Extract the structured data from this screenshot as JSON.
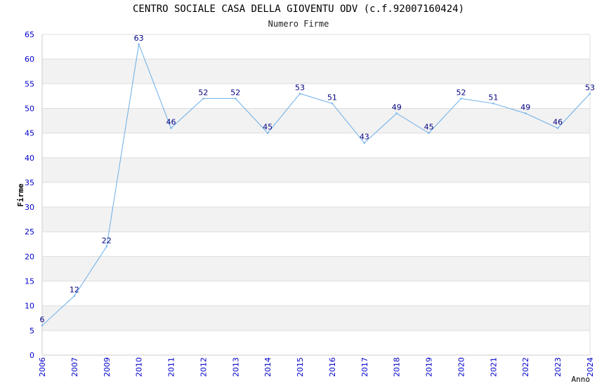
{
  "chart_data": {
    "type": "line",
    "title": "CENTRO SOCIALE CASA DELLA GIOVENTU ODV (c.f.92007160424)",
    "subtitle": "Numero Firme",
    "xlabel": "Anno",
    "ylabel": "Firme",
    "categories": [
      "2006",
      "2007",
      "2009",
      "2010",
      "2011",
      "2012",
      "2013",
      "2014",
      "2015",
      "2016",
      "2017",
      "2018",
      "2019",
      "2020",
      "2021",
      "2022",
      "2023",
      "2024"
    ],
    "series": [
      {
        "values": [
          6,
          12,
          22,
          63,
          46,
          52,
          52,
          45,
          53,
          51,
          43,
          49,
          45,
          52,
          51,
          49,
          46,
          53
        ]
      }
    ],
    "ylim": [
      0,
      65
    ],
    "yticks": [
      0,
      5,
      10,
      15,
      20,
      25,
      30,
      35,
      40,
      45,
      50,
      55,
      60,
      65
    ],
    "grid": "horizontal alternating bands",
    "colors": {
      "line": "#6aaee8",
      "band": "#f2f2f2",
      "tick_label": "#0000cc",
      "data_label": "#000080",
      "grid_line": "#dddddd"
    }
  }
}
